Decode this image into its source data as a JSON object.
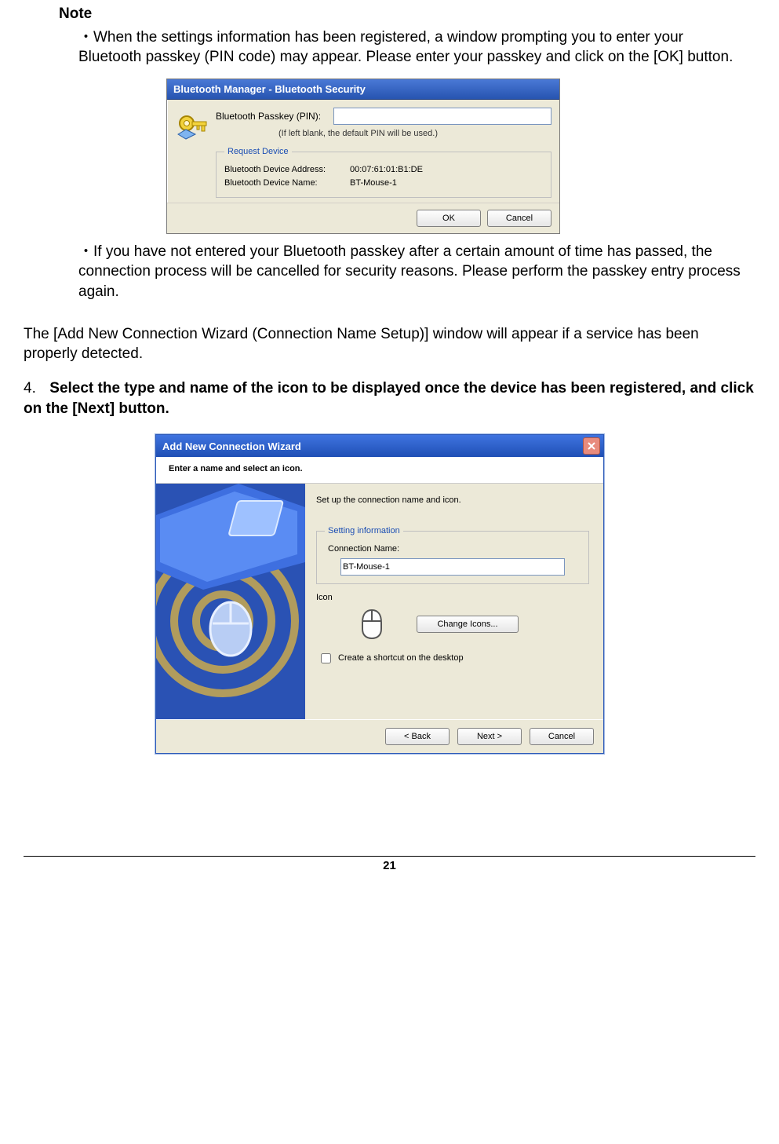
{
  "note": {
    "heading": "Note",
    "bullet1": "・When the settings information has been registered, a window prompting you to enter your Bluetooth passkey (PIN code) may appear. Please enter your passkey and click on the [OK] button.",
    "bullet2": "・If you have not entered your Bluetooth passkey after a certain amount of time has passed, the connection process will be cancelled for security reasons. Please perform the passkey entry process again."
  },
  "dlg1": {
    "title": "Bluetooth Manager - Bluetooth Security",
    "passkey_label": "Bluetooth Passkey (PIN):",
    "hint": "(If left blank, the default PIN will be used.)",
    "group": "Request Device",
    "addr_label": "Bluetooth Device Address:",
    "addr_value": "00:07:61:01:B1:DE",
    "name_label": "Bluetooth Device Name:",
    "name_value": "BT-Mouse-1",
    "ok": "OK",
    "cancel": "Cancel"
  },
  "mid_para": "The [Add New Connection Wizard (Connection Name Setup)] window will appear if a service has been properly detected.",
  "step4": {
    "num": "4.",
    "text": "Select the type and name of the icon to be displayed once the device has been registered, and click on the [Next] button."
  },
  "dlg2": {
    "title": "Add New Connection Wizard",
    "header": "Enter a name and select an icon.",
    "intro": "Set up the connection name and icon.",
    "group": "Setting information",
    "cn_label": "Connection Name:",
    "cn_value": "BT-Mouse-1",
    "icon_label": "Icon",
    "change": "Change Icons...",
    "shortcut": "Create a shortcut on the desktop",
    "back": "< Back",
    "next": "Next >",
    "cancel": "Cancel"
  },
  "page_number": "21"
}
